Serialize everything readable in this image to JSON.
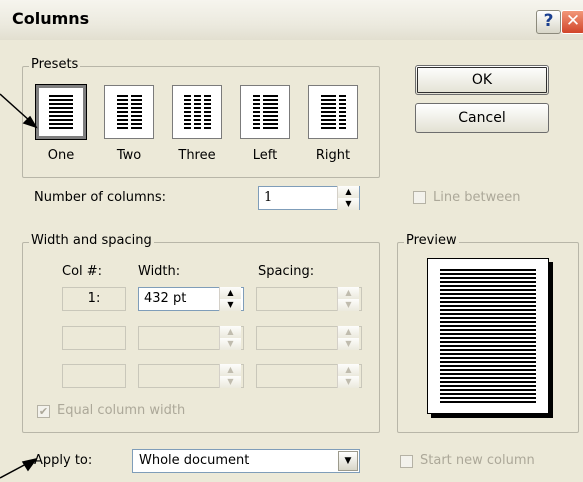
{
  "window": {
    "title": "Columns",
    "help_glyph": "?",
    "close_glyph": "✕"
  },
  "presets": {
    "group_label": "Presets",
    "items": [
      {
        "label": "One",
        "selected": true
      },
      {
        "label": "Two",
        "selected": false
      },
      {
        "label": "Three",
        "selected": false
      },
      {
        "label": "Left",
        "selected": false
      },
      {
        "label": "Right",
        "selected": false
      }
    ]
  },
  "buttons": {
    "ok": "OK",
    "cancel": "Cancel"
  },
  "number_of_columns": {
    "label": "Number of columns:",
    "value": "1"
  },
  "line_between": {
    "label": "Line between",
    "checked": false,
    "enabled": false
  },
  "width_spacing": {
    "group_label": "Width and spacing",
    "headers": {
      "col": "Col #:",
      "width": "Width:",
      "spacing": "Spacing:"
    },
    "rows": [
      {
        "col": "1:",
        "width": "432 pt",
        "spacing": ""
      },
      {
        "col": "",
        "width": "",
        "spacing": ""
      },
      {
        "col": "",
        "width": "",
        "spacing": ""
      }
    ],
    "equal_width": {
      "label": "Equal column width",
      "checked": true,
      "enabled": false
    }
  },
  "preview": {
    "group_label": "Preview"
  },
  "apply_to": {
    "label": "Apply to:",
    "value": "Whole document"
  },
  "start_new_column": {
    "label": "Start new column",
    "checked": false,
    "enabled": false
  },
  "colors": {
    "dialog_bg": "#ece9d8",
    "close_red": "#d1452a",
    "disabled_text": "#aca899"
  }
}
